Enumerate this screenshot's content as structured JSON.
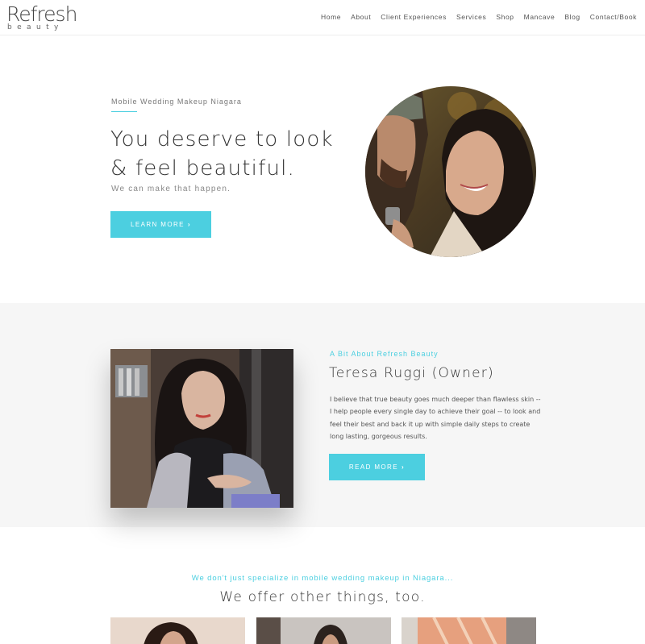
{
  "header": {
    "logo_main": "Refresh",
    "logo_sub": "beauty",
    "nav": [
      "Home",
      "About",
      "Client Experiences",
      "Services",
      "Shop",
      "Mancave",
      "Blog",
      "Contact/Book"
    ]
  },
  "hero": {
    "eyebrow": "Mobile Wedding Makeup Niagara",
    "title_line1": "You deserve to look",
    "title_line2": "& feel beautiful.",
    "subtitle": "We can make that happen.",
    "button_label": "LEARN MORE",
    "button_icon": "chevron-right-icon"
  },
  "about": {
    "eyebrow": "A Bit About Refresh Beauty",
    "title": "Teresa Ruggi (Owner)",
    "body": "I believe that true beauty goes much deeper than flawless skin -- I help people every single day to achieve their goal -- to look and feel their best and back it up with simple daily steps to create long lasting, gorgeous results.",
    "button_label": "READ MORE",
    "button_icon": "chevron-right-icon"
  },
  "services": {
    "eyebrow": "We don't just specialize in mobile wedding makeup in Niagara...",
    "title": "We offer other things, too."
  },
  "colors": {
    "accent": "#4ccfe0",
    "band": "#f6f6f6",
    "text": "#333333"
  }
}
